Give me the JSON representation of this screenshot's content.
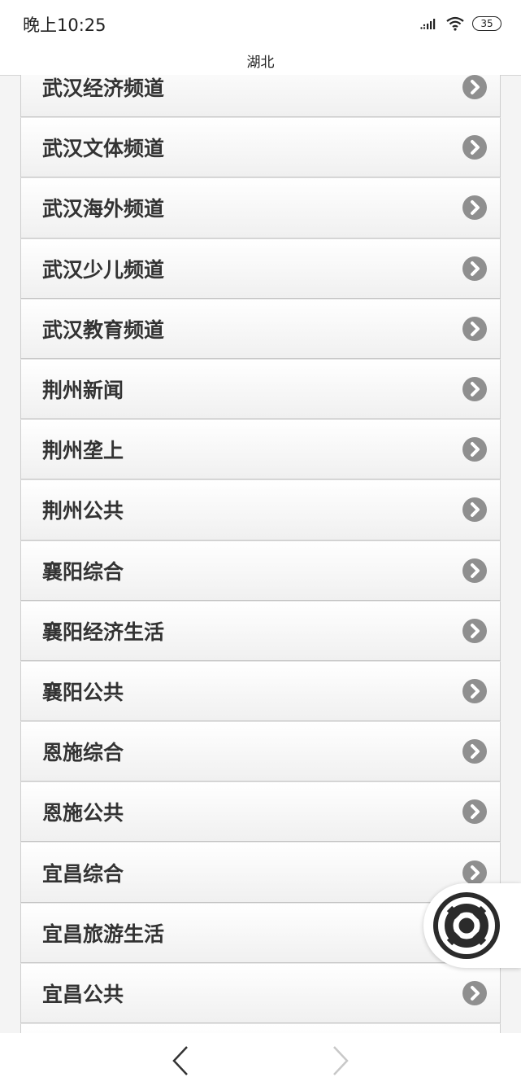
{
  "status_bar": {
    "time": "晚上10:25",
    "battery": "35",
    "icons": [
      "signal-icon",
      "wifi-icon",
      "battery-icon"
    ]
  },
  "header": {
    "title": "湖北"
  },
  "channels": [
    {
      "label": "武汉经济频道"
    },
    {
      "label": "武汉文体频道"
    },
    {
      "label": "武汉海外频道"
    },
    {
      "label": "武汉少儿频道"
    },
    {
      "label": "武汉教育频道"
    },
    {
      "label": "荆州新闻"
    },
    {
      "label": "荆州垄上"
    },
    {
      "label": "荆州公共"
    },
    {
      "label": "襄阳综合"
    },
    {
      "label": "襄阳经济生活"
    },
    {
      "label": "襄阳公共"
    },
    {
      "label": "恩施综合"
    },
    {
      "label": "恩施公共"
    },
    {
      "label": "宜昌综合"
    },
    {
      "label": "宜昌旅游生活"
    },
    {
      "label": "宜昌公共"
    },
    {
      "label": ""
    }
  ],
  "row_icon": "chevron-right-circle-icon",
  "floating_button_icon": "assistive-touch-icon",
  "bottom_nav": {
    "back_icon": "chevron-left-icon",
    "forward_icon": "chevron-right-icon"
  },
  "colors": {
    "label": "#333333",
    "arrow": "#8f8f8f",
    "row_border": "#c4c4c4",
    "background": "#f4f4f4"
  }
}
